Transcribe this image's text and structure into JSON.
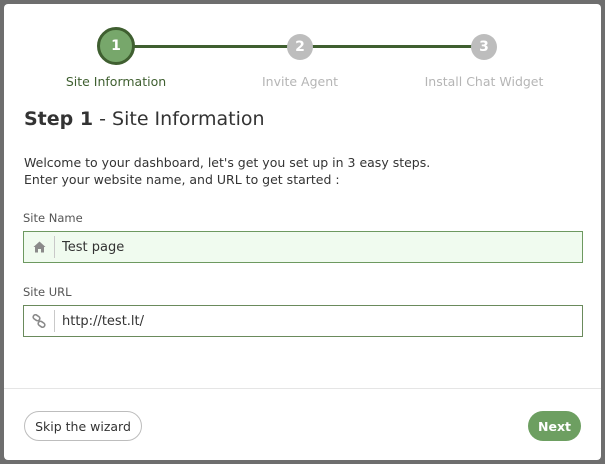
{
  "wizard": {
    "steps": [
      {
        "number": "1",
        "label": "Site Information",
        "state": "active"
      },
      {
        "number": "2",
        "label": "Invite Agent",
        "state": "inactive"
      },
      {
        "number": "3",
        "label": "Install Chat Widget",
        "state": "inactive"
      }
    ],
    "colors": {
      "accent": "#77a76b",
      "accent_dark": "#3f5f30",
      "inactive": "#bdbdbd"
    }
  },
  "heading": {
    "step": "Step 1",
    "separator": " - ",
    "title": "Site Information"
  },
  "intro": {
    "line1": "Welcome to your dashboard, let's get you set up in 3 easy steps.",
    "line2": "Enter your website name, and URL to get started :"
  },
  "form": {
    "site_name": {
      "label": "Site Name",
      "value": "Test page",
      "icon": "home-icon"
    },
    "site_url": {
      "label": "Site URL",
      "value": "http://test.lt/",
      "icon": "link-icon"
    }
  },
  "footer": {
    "skip_label": "Skip the wizard",
    "next_label": "Next"
  }
}
